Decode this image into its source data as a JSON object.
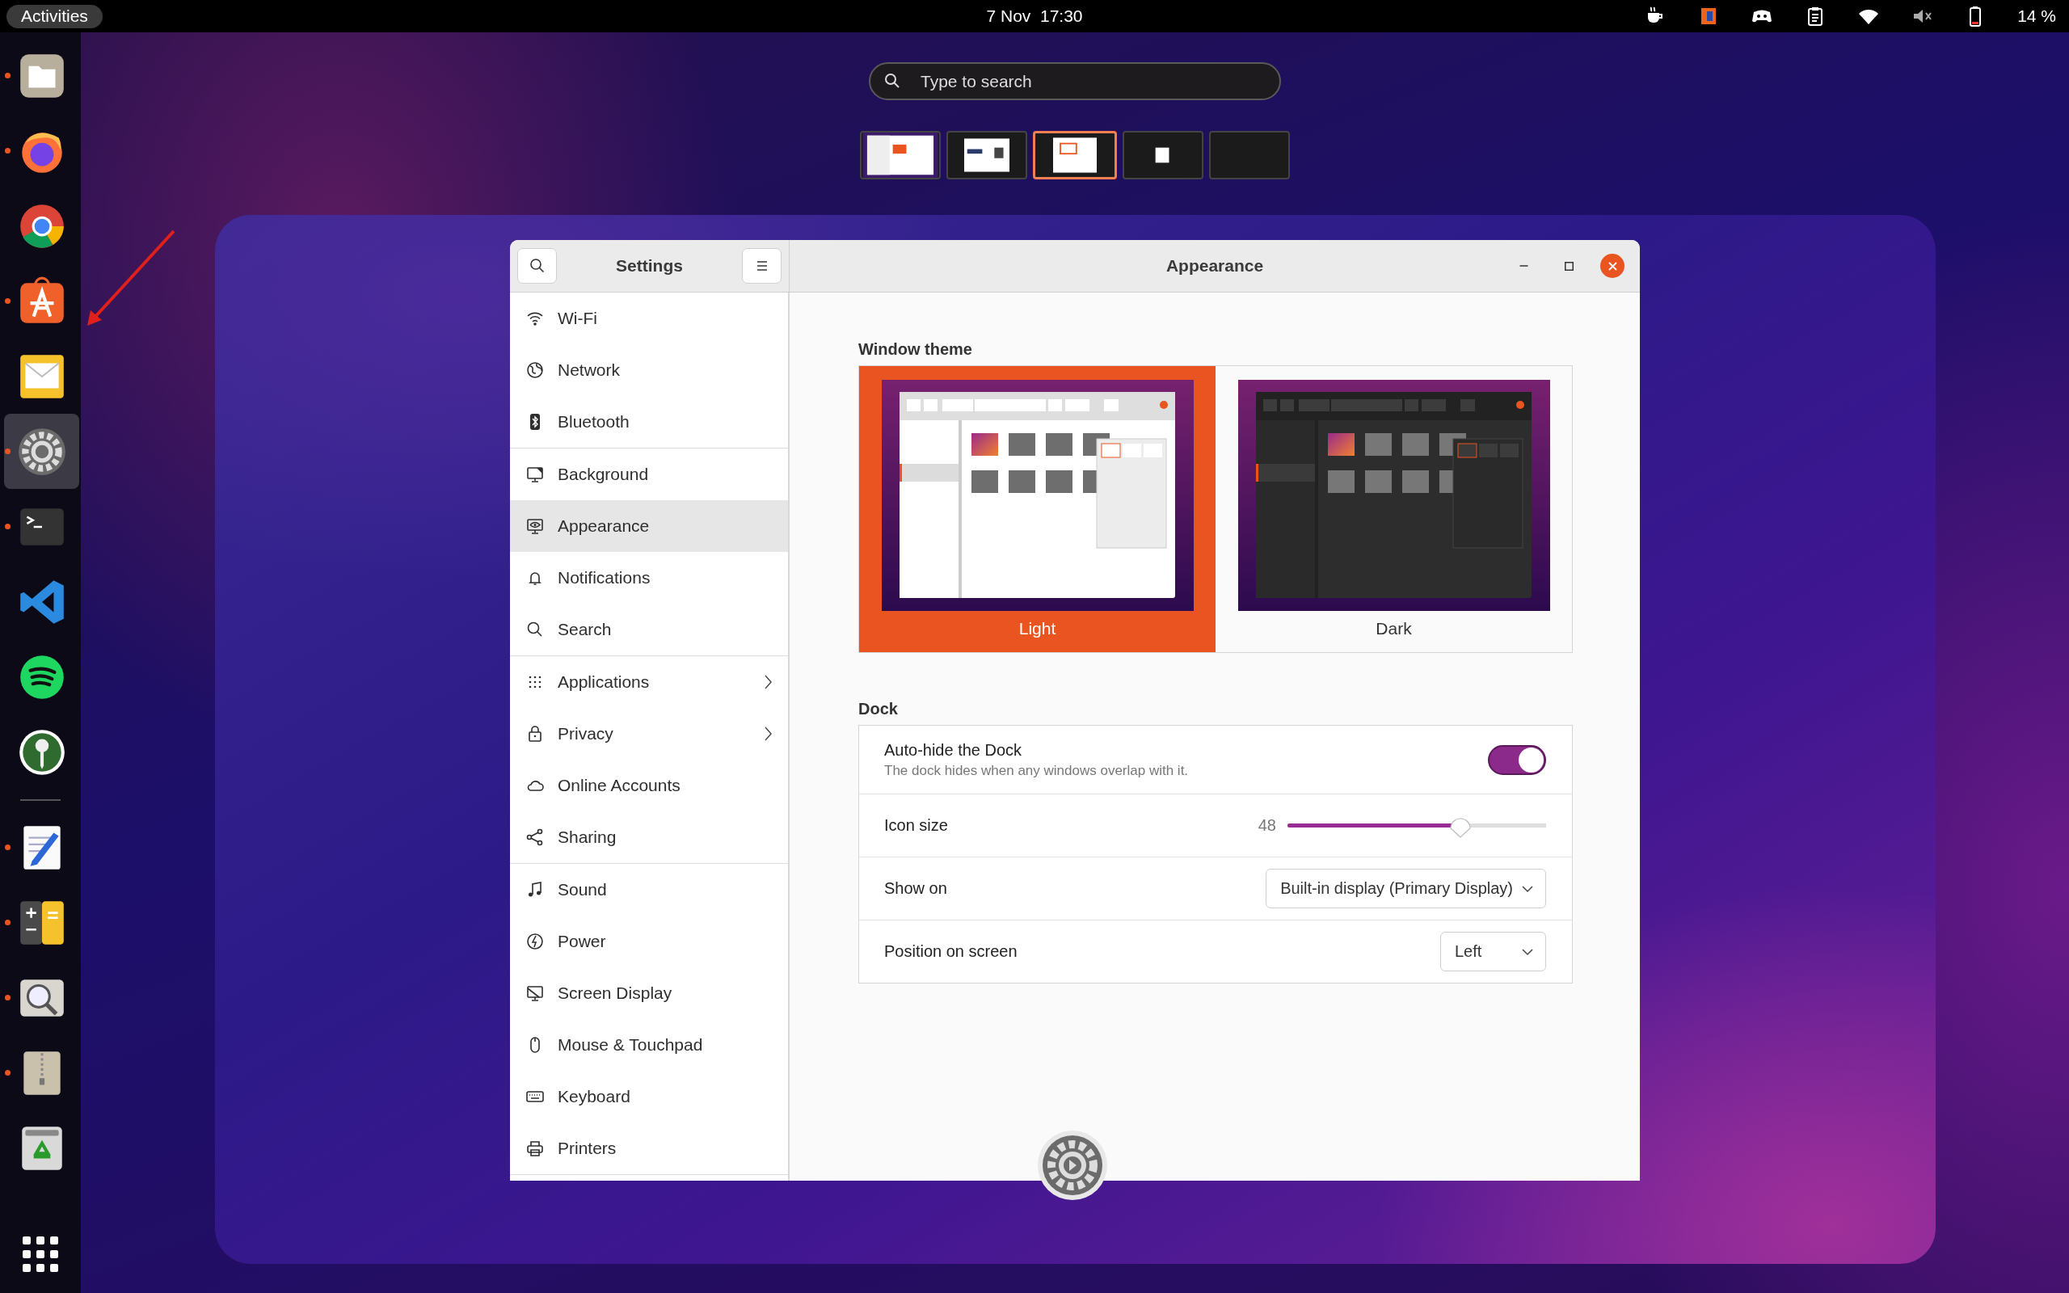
{
  "top_bar": {
    "activities": "Activities",
    "clock": "7 Nov  17:30",
    "battery": "14 %"
  },
  "dock": {
    "groups": [
      [
        {
          "running": true,
          "selected": false
        },
        {
          "running": true,
          "selected": false
        },
        {
          "running": false,
          "selected": false
        },
        {
          "running": true,
          "selected": false
        },
        {
          "running": false,
          "selected": false
        },
        {
          "running": true,
          "selected": true
        },
        {
          "running": true,
          "selected": false
        },
        {
          "running": false,
          "selected": false
        },
        {
          "running": false,
          "selected": false
        },
        {
          "running": false,
          "selected": false
        }
      ],
      [
        {
          "running": true,
          "selected": false
        },
        {
          "running": true,
          "selected": false
        },
        {
          "running": true,
          "selected": false
        },
        {
          "running": true,
          "selected": false
        },
        {
          "running": false,
          "selected": false
        }
      ]
    ]
  },
  "overview": {
    "search": {
      "placeholder": "Type to search"
    },
    "workspaces": [
      {
        "selected": false
      },
      {
        "selected": false
      },
      {
        "selected": true
      },
      {
        "selected": false
      },
      {
        "selected": false
      }
    ]
  },
  "window": {
    "sidebar": {
      "title": "Settings",
      "groups": [
        [
          {
            "label": "Wi-Fi",
            "selected": false,
            "submenu": false
          },
          {
            "label": "Network",
            "selected": false,
            "submenu": false
          },
          {
            "label": "Bluetooth",
            "selected": false,
            "submenu": false
          }
        ],
        [
          {
            "label": "Background",
            "selected": false,
            "submenu": false
          },
          {
            "label": "Appearance",
            "selected": true,
            "submenu": false
          },
          {
            "label": "Notifications",
            "selected": false,
            "submenu": false
          },
          {
            "label": "Search",
            "selected": false,
            "submenu": false
          }
        ],
        [
          {
            "label": "Applications",
            "selected": false,
            "submenu": true
          },
          {
            "label": "Privacy",
            "selected": false,
            "submenu": true
          },
          {
            "label": "Online Accounts",
            "selected": false,
            "submenu": false
          },
          {
            "label": "Sharing",
            "selected": false,
            "submenu": false
          }
        ],
        [
          {
            "label": "Sound",
            "selected": false,
            "submenu": false
          },
          {
            "label": "Power",
            "selected": false,
            "submenu": false
          },
          {
            "label": "Screen Display",
            "selected": false,
            "submenu": false
          },
          {
            "label": "Mouse & Touchpad",
            "selected": false,
            "submenu": false
          },
          {
            "label": "Keyboard",
            "selected": false,
            "submenu": false
          },
          {
            "label": "Printers",
            "selected": false,
            "submenu": false
          }
        ]
      ]
    },
    "title": "Appearance",
    "sections": [
      {
        "title": "Window theme",
        "kind": "themes",
        "options": [
          {
            "label": "Light",
            "kind": "light",
            "selected": true
          },
          {
            "label": "Dark",
            "kind": "dark",
            "selected": false
          }
        ]
      },
      {
        "title": "Dock",
        "kind": "rows",
        "rows": [
          {
            "kind": "switch",
            "label": "Auto-hide the Dock",
            "description": "The dock hides when any windows overlap with it.",
            "on": true
          },
          {
            "kind": "slider",
            "label": "Icon size",
            "reading": "48",
            "level": 0.67
          },
          {
            "kind": "dropdown",
            "label": "Show on",
            "value": "Built-in display (Primary Display)"
          },
          {
            "kind": "dropdown",
            "label": "Position on screen",
            "value": "Left"
          }
        ]
      }
    ]
  }
}
